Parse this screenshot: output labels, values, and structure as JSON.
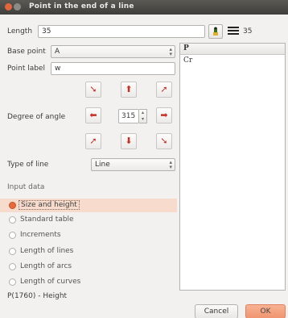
{
  "window": {
    "title": "Point in the end of a line"
  },
  "length": {
    "label": "Length",
    "value": "35",
    "line_width_value": "35"
  },
  "base_point": {
    "label": "Base point",
    "value": "A"
  },
  "point_label": {
    "label": "Point label",
    "value": "w"
  },
  "angle": {
    "label": "Degree of angle",
    "value": "315"
  },
  "line_type": {
    "label": "Type of line",
    "value": "Line"
  },
  "input_data": {
    "label": "Input data",
    "options": [
      "Size and height",
      "Standard table",
      "Increments",
      "Length of lines",
      "Length of arcs",
      "Length of curves"
    ],
    "selected_index": 0,
    "description": "P(1760) - Height"
  },
  "table": {
    "header": "P",
    "rows": [
      "Cr"
    ]
  },
  "buttons": {
    "cancel": "Cancel",
    "ok": "OK"
  },
  "colors": {
    "accent": "#e46b3d",
    "arrow": "#c0322a",
    "ok_button": "#f09470"
  }
}
